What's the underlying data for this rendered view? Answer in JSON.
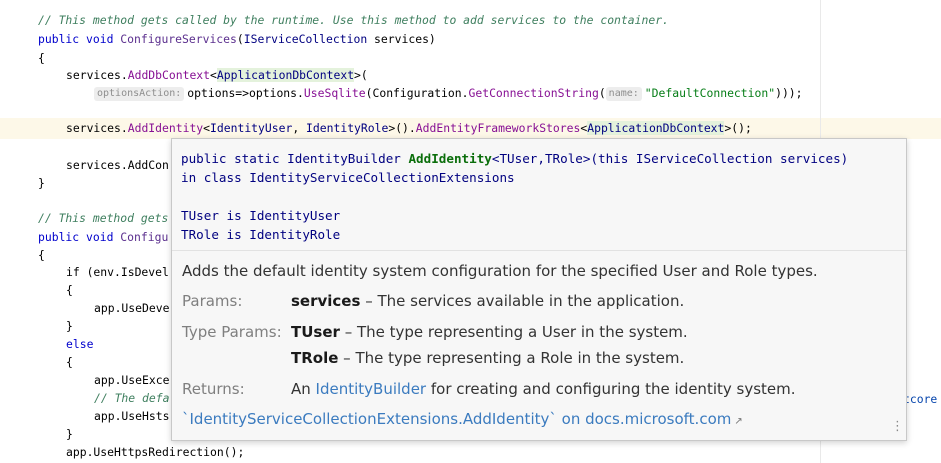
{
  "code": {
    "l1": "// This method gets called by the runtime. Use this method to add services to the container.",
    "l2_kw": "public void ",
    "l2_m": "ConfigureServices",
    "l2_t": "IServiceCollection",
    "l2_rest": " services)",
    "brace_open": "{",
    "l4_a": "services.",
    "l4_m": "AddDbContext",
    "l4_t": "ApplicationDbContext",
    "l4_e": ">(",
    "l5_hint": "optionsAction:",
    "l5_a": "options=>options.",
    "l5_m1": "UseSqlite",
    "l5_b": "(Configuration.",
    "l5_m2": "GetConnectionString",
    "l5_c": "(",
    "l5_hint2": "name:",
    "l5_str": "\"DefaultConnection\"",
    "l5_e": ")));",
    "l7_a": "services.",
    "l7_m": "AddIdentity",
    "l7_t1": "IdentityUser",
    "l7_t2": "IdentityRole",
    "l7_b": ">().",
    "l7_m2": "AddEntityFrameworkStores",
    "l7_t3": "ApplicationDbContext",
    "l7_e": ">();",
    "l9": "services.AddCon",
    "brace_close": "}",
    "l12": "// This method gets",
    "l13_kw": "public void ",
    "l13_m": "Configu",
    "l15": "if (env.IsDevel",
    "l17": "app.UseDeve",
    "l19": "else",
    "l21": "app.UseExce",
    "l22": "// The defa",
    "l23": "app.UseHsts",
    "l25": "app.UseHttpsRedirection();",
    "trail": "tcore"
  },
  "popup": {
    "sig1_a": "public static IdentityBuilder ",
    "sig1_b": "AddIdentity",
    "sig1_c": "<TUser,TRole>(this IServiceCollection services)",
    "sig2": "in class IdentityServiceCollectionExtensions",
    "tuser": "TUser is IdentityUser",
    "trole": "TRole is IdentityRole",
    "summary": "Adds the default identity system configuration for the specified User and Role types.",
    "params_label": "Params:",
    "param_name": "services",
    "param_desc": " – The services available in the application.",
    "type_params_label": "Type Params:",
    "tp1_name": "TUser",
    "tp1_desc": " – The type representing a User in the system.",
    "tp2_name": "TRole",
    "tp2_desc": " – The type representing a Role in the system.",
    "returns_label": "Returns:",
    "returns_a": "An ",
    "returns_link": "IdentityBuilder",
    "returns_b": " for creating and configuring the identity system.",
    "doc_link": "`IdentityServiceCollectionExtensions.AddIdentity` on docs.microsoft.com",
    "ext_icon": "↗",
    "menu_icon": "⋮"
  }
}
